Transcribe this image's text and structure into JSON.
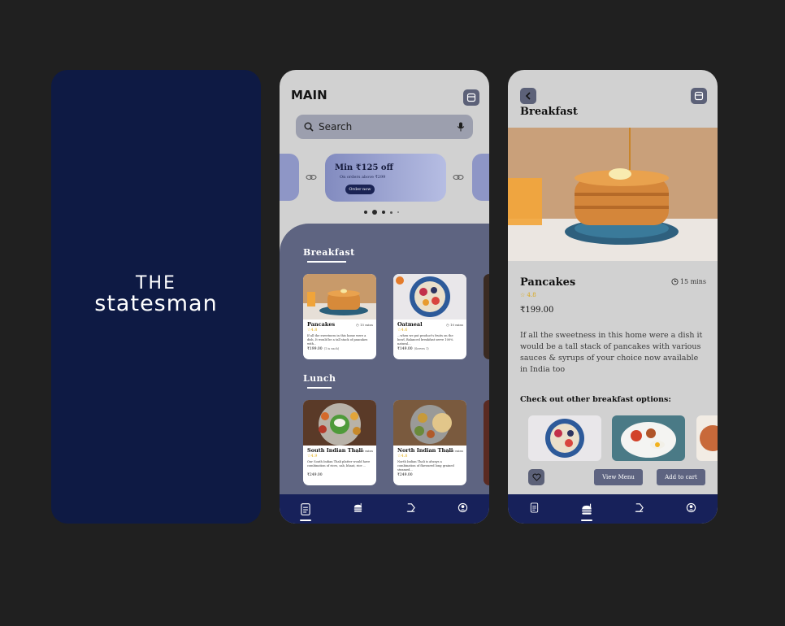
{
  "splash": {
    "logo_line1": "THE",
    "logo_line2": "statesman"
  },
  "main": {
    "title": "MAIN",
    "search": {
      "placeholder": "Search"
    },
    "promo": {
      "title": "Min ₹125 off",
      "subtitle": "On orders above ₹299",
      "button": "Order now"
    },
    "sections": [
      {
        "title": "Breakfast",
        "items": [
          {
            "name": "Pancakes",
            "time": "15 mins",
            "rating": "4.8",
            "desc": "If all the sweetness in this home were a dish, It would be a tall stack of pancakes with...",
            "price": "₹199.00",
            "servings": "(1 is each)"
          },
          {
            "name": "Oatmeal",
            "time": "10 mins",
            "rating": "4.6",
            "desc": "...when we put product's fruits on the bowl, Balanced breakfast serve 100% natural...",
            "price": "₹149.00",
            "servings": "(Serves 1)"
          }
        ]
      },
      {
        "title": "Lunch",
        "items": [
          {
            "name": "South Indian Thali",
            "time": "20 mins",
            "rating": "4.9",
            "desc": "Our South Indian Thali platter would have combination of rices, sab, bhaat, rice ...",
            "price": "₹249.00"
          },
          {
            "name": "North Indian Thali",
            "time": "25 mins",
            "rating": "4.8",
            "desc": "North Indian Thali is always a combination of flavoured long grained steamed...",
            "price": "₹249.00"
          }
        ]
      }
    ]
  },
  "detail": {
    "title": "Breakfast",
    "item_name": "Pancakes",
    "time": "15 mins",
    "rating": "4.8",
    "price": "₹199.00",
    "description": "If all the sweetness in this home were a dish it would be a tall stack of pancakes with various sauces & syrups of your choice now available in India too",
    "other_options_title": "Check out other breakfast options:",
    "view_menu": "View Menu",
    "add_to_cart": "Add to cart"
  },
  "colors": {
    "navy": "#17215a",
    "splash_bg": "#0e1a44",
    "sheet": "#5e6481",
    "panel": "#d1d1d1",
    "star": "#e5b120"
  },
  "icons": [
    "cart-icon",
    "search-icon",
    "mic-icon",
    "link-icon",
    "menu-doc-icon",
    "burger-icon",
    "order-icon",
    "profile-icon",
    "back-icon",
    "heart-icon",
    "clock-icon",
    "star-icon"
  ]
}
